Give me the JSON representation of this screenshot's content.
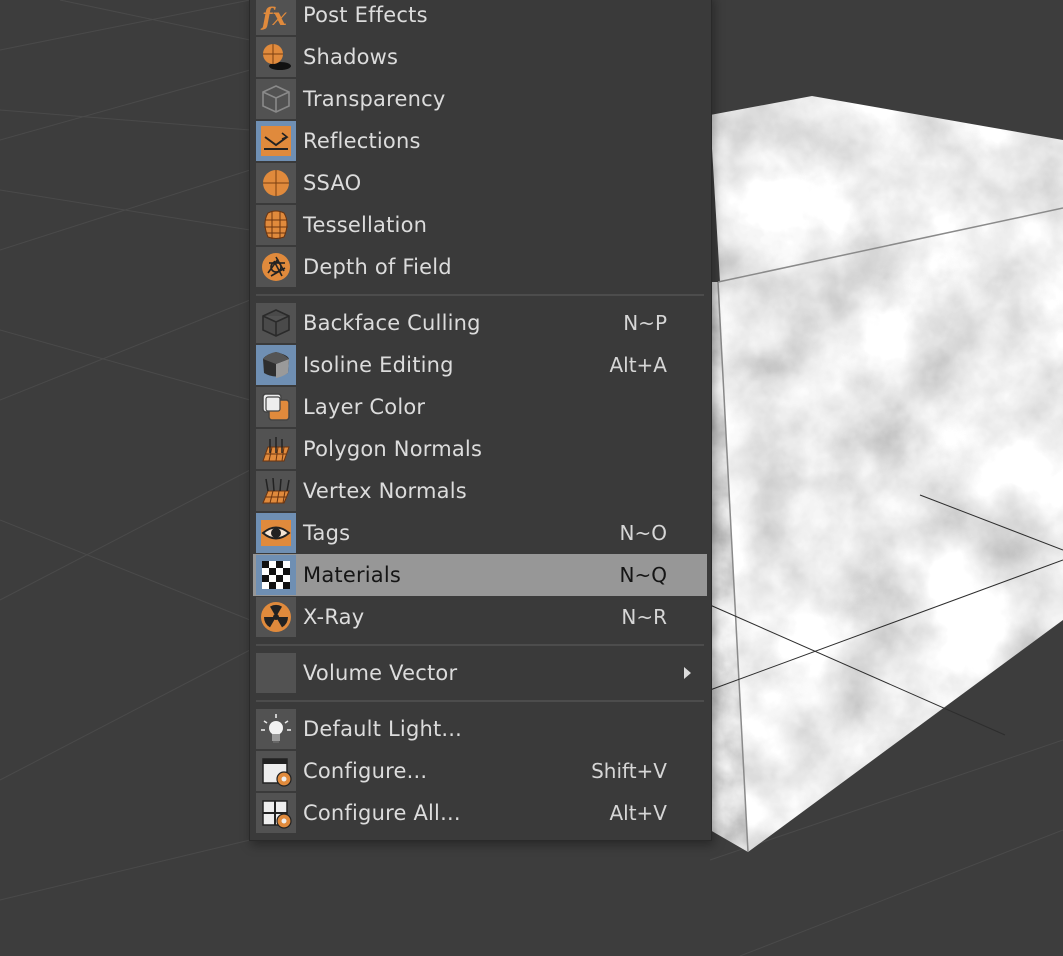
{
  "colors": {
    "viewport_background": "#3d3d3d",
    "menu_background": "#3a3a3a",
    "highlight": "#979797",
    "icon_accent": "#e08a3c",
    "icon_checked_background": "#6f8fb3"
  },
  "menu": {
    "groups": [
      [
        {
          "label": "Post Effects",
          "shortcut": "",
          "icon": "fx-icon",
          "checked": false
        },
        {
          "label": "Shadows",
          "shortcut": "",
          "icon": "shadows-icon",
          "checked": false
        },
        {
          "label": "Transparency",
          "shortcut": "",
          "icon": "transparency-cube-icon",
          "checked": false
        },
        {
          "label": "Reflections",
          "shortcut": "",
          "icon": "reflections-icon",
          "checked": true
        },
        {
          "label": "SSAO",
          "shortcut": "",
          "icon": "ssao-sphere-icon",
          "checked": false
        },
        {
          "label": "Tessellation",
          "shortcut": "",
          "icon": "tessellation-icon",
          "checked": false
        },
        {
          "label": "Depth of Field",
          "shortcut": "",
          "icon": "aperture-icon",
          "checked": false
        }
      ],
      [
        {
          "label": "Backface Culling",
          "shortcut": "N~P",
          "icon": "backface-cube-icon",
          "checked": false
        },
        {
          "label": "Isoline Editing",
          "shortcut": "Alt+A",
          "icon": "isoline-cube-icon",
          "checked": true
        },
        {
          "label": "Layer Color",
          "shortcut": "",
          "icon": "layer-color-icon",
          "checked": false
        },
        {
          "label": "Polygon Normals",
          "shortcut": "",
          "icon": "polygon-normals-icon",
          "checked": false
        },
        {
          "label": "Vertex Normals",
          "shortcut": "",
          "icon": "vertex-normals-icon",
          "checked": false
        },
        {
          "label": "Tags",
          "shortcut": "N~O",
          "icon": "eye-icon",
          "checked": true
        },
        {
          "label": "Materials",
          "shortcut": "N~Q",
          "icon": "checkerboard-icon",
          "checked": true,
          "highlighted": true
        },
        {
          "label": "X-Ray",
          "shortcut": "N~R",
          "icon": "radiation-icon",
          "checked": false
        }
      ],
      [
        {
          "label": "Volume Vector",
          "shortcut": "",
          "icon": "blank-icon",
          "checked": false,
          "submenu": true
        }
      ],
      [
        {
          "label": "Default Light...",
          "shortcut": "",
          "icon": "lightbulb-icon",
          "checked": false
        },
        {
          "label": "Configure...",
          "shortcut": "Shift+V",
          "icon": "configure-gear-icon",
          "checked": false
        },
        {
          "label": "Configure All...",
          "shortcut": "Alt+V",
          "icon": "configure-all-gear-icon",
          "checked": false
        }
      ]
    ]
  }
}
